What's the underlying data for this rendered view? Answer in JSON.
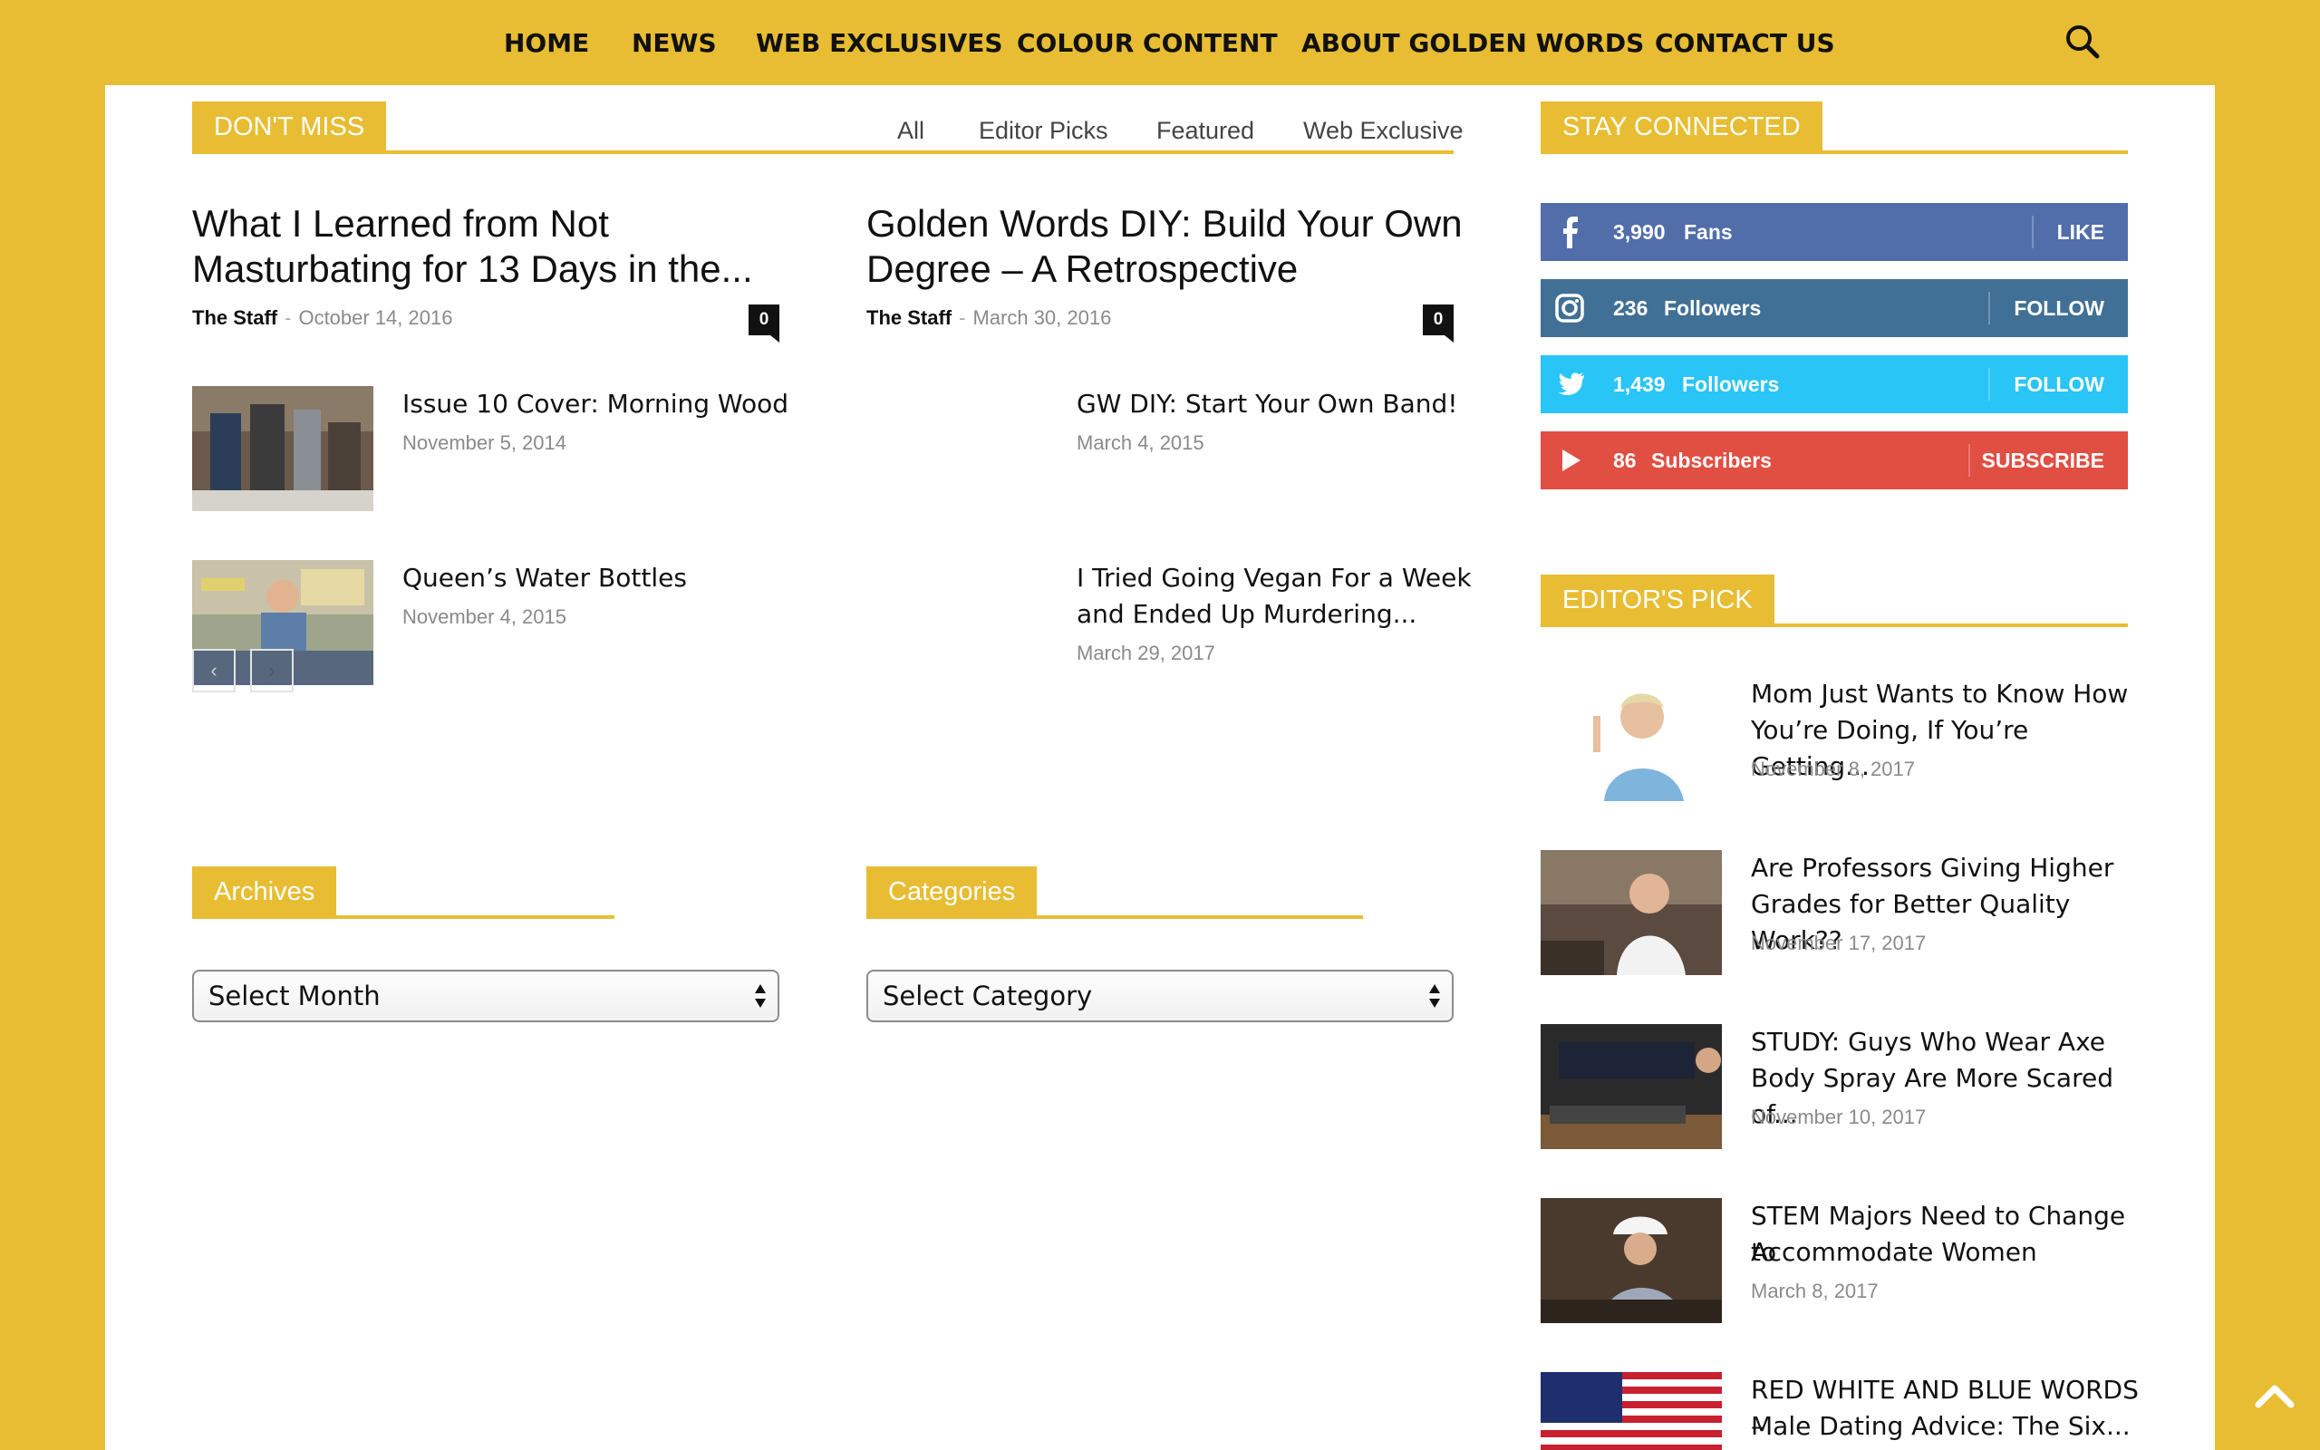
{
  "nav": {
    "items": [
      "HOME",
      "NEWS",
      "WEB EXCLUSIVES",
      "COLOUR CONTENT",
      "ABOUT GOLDEN WORDS",
      "CONTACT US"
    ],
    "search_icon": "search-icon"
  },
  "dont_miss": {
    "heading": "DON'T MISS",
    "filters": [
      "All",
      "Editor Picks",
      "Featured",
      "Web Exclusive"
    ],
    "featured": [
      {
        "title": "What I Learned from Not Masturbating for 13 Days in the...",
        "author": "The Staff",
        "date": "October 14, 2016",
        "comments": "0"
      },
      {
        "title": "Golden Words DIY: Build Your Own Degree – A Retrospective",
        "author": "The Staff",
        "date": "March 30, 2016",
        "comments": "0"
      }
    ],
    "left_list": [
      {
        "title": "Issue 10 Cover: Morning Wood",
        "date": "November 5, 2014"
      },
      {
        "title": "Queen’s Water Bottles",
        "date": "November 4, 2015"
      }
    ],
    "right_list": [
      {
        "title": "GW DIY: Start Your Own Band!",
        "date": "March 4, 2015"
      },
      {
        "title_line1": "I Tried Going Vegan For a Week",
        "title_line2": "and Ended Up Murdering...",
        "date": "March 29, 2017"
      }
    ],
    "pager": {
      "prev": "‹",
      "next": "›"
    }
  },
  "archives": {
    "heading": "Archives",
    "select_value": "Select Month"
  },
  "categories": {
    "heading": "Categories",
    "select_value": "Select Category"
  },
  "stay_connected": {
    "heading": "STAY CONNECTED",
    "networks": [
      {
        "count": "3,990",
        "label": "Fans",
        "action": "LIKE",
        "color": "#516eab",
        "icon": "facebook-icon"
      },
      {
        "count": "236",
        "label": "Followers",
        "action": "FOLLOW",
        "color": "#417096",
        "icon": "instagram-icon"
      },
      {
        "count": "1,439",
        "label": "Followers",
        "action": "FOLLOW",
        "color": "#29c5f6",
        "icon": "twitter-icon"
      },
      {
        "count": "86",
        "label": "Subscribers",
        "action": "SUBSCRIBE",
        "color": "#e14e42",
        "icon": "youtube-icon"
      }
    ]
  },
  "editors_pick": {
    "heading": "EDITOR'S PICK",
    "items": [
      {
        "l1": "Mom Just Wants to Know How",
        "l2": "You’re Doing, If You’re Getting...",
        "date": "November 8, 2017"
      },
      {
        "l1": "Are Professors Giving Higher",
        "l2": "Grades for Better Quality Work??",
        "date": "November 17, 2017"
      },
      {
        "l1": "STUDY: Guys Who Wear Axe",
        "l2": "Body Spray Are More Scared of...",
        "date": "November 10, 2017"
      },
      {
        "l1": "STEM Majors Need to Change to",
        "l2": "Accommodate Women",
        "date": "March 8, 2017"
      },
      {
        "l1": "RED WHITE AND BLUE WORDS –",
        "l2": "Male Dating Advice: The Six...",
        "date": ""
      }
    ]
  },
  "colors": {
    "accent": "#e8bd33",
    "text": "#111111",
    "muted": "#8a8a8a"
  }
}
